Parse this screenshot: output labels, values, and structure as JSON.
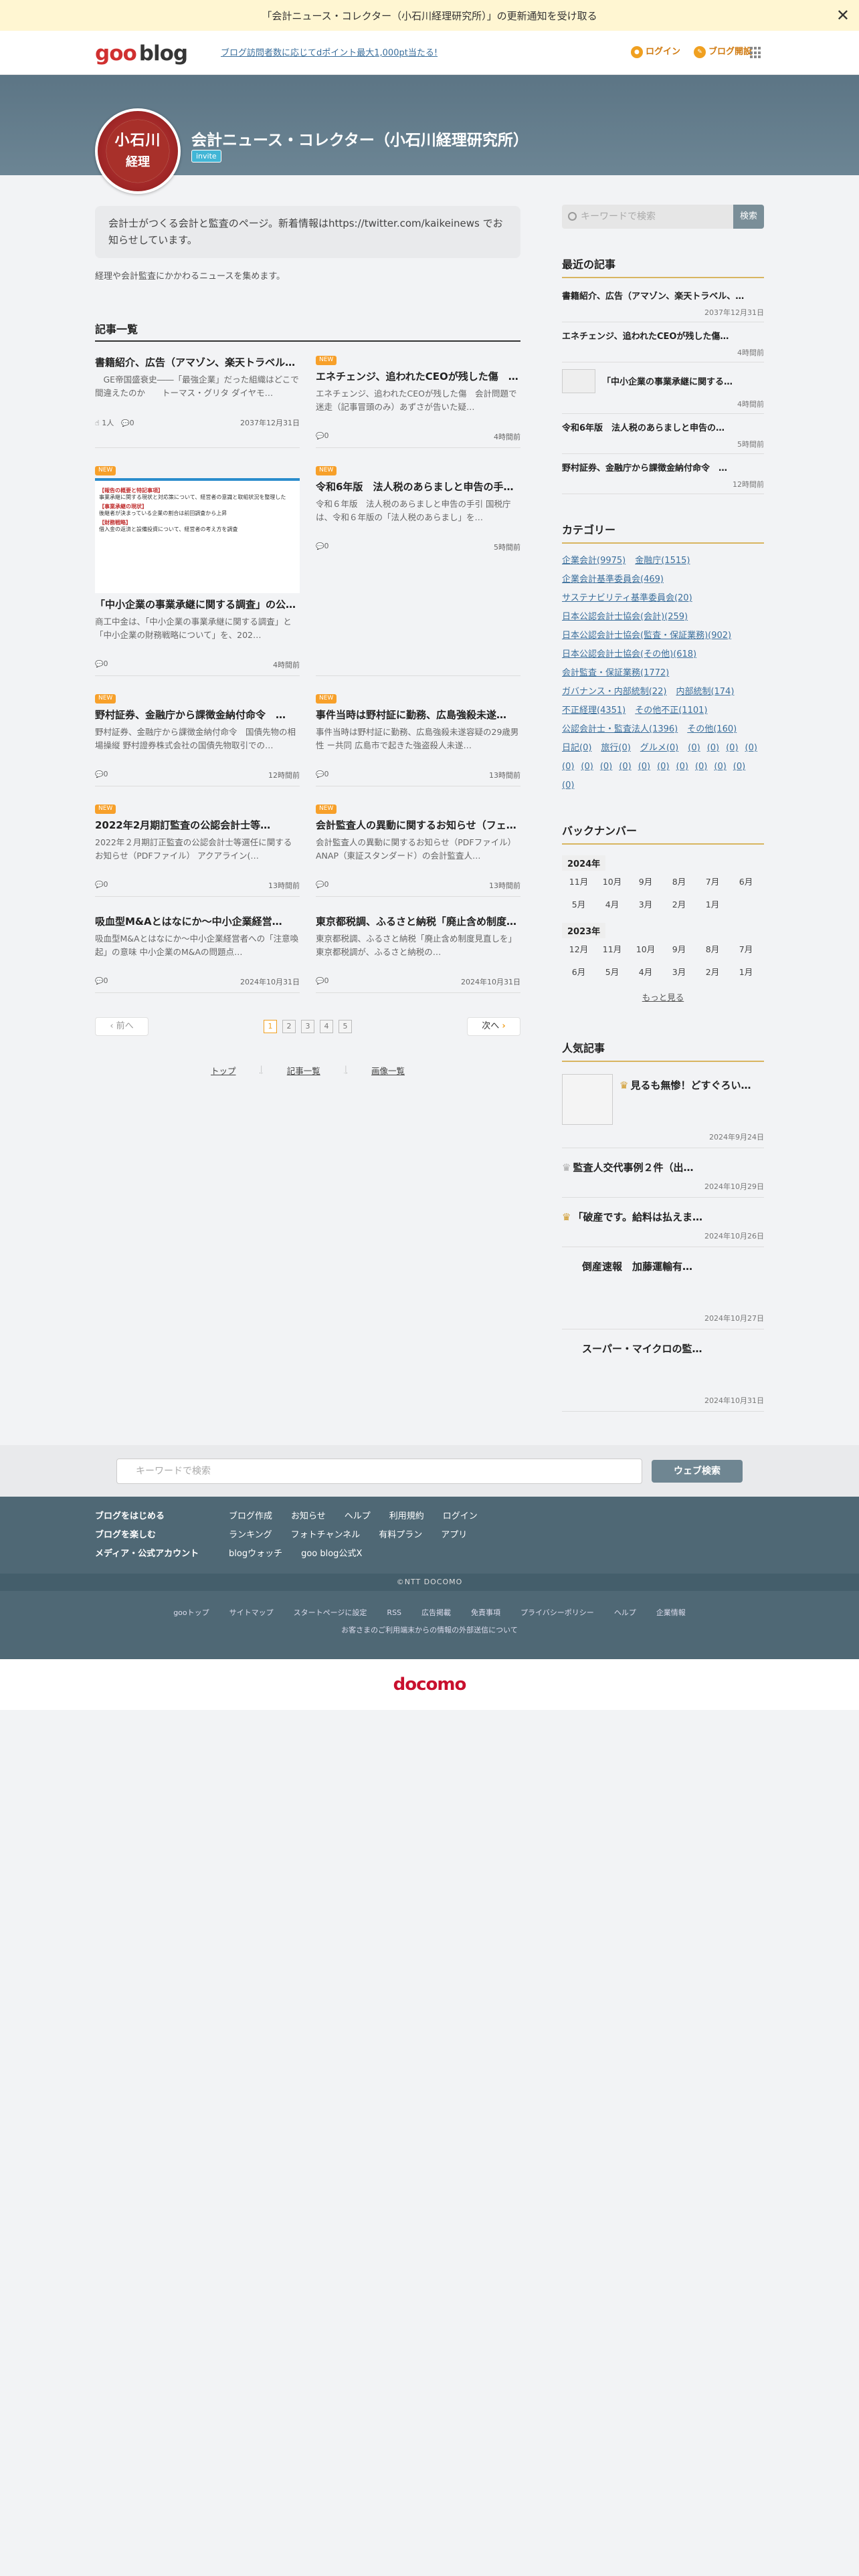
{
  "notice": {
    "text": "「会計ニュース・コレクター（小石川経理研究所）」の更新通知を受け取る",
    "close": "✕"
  },
  "header": {
    "logo_goo": "goo",
    "logo_blog": "blog",
    "promo": "ブログ訪問者数に応じてdポイント最大1,000pt当たる!",
    "login": "ログイン",
    "open": "ブログ開設"
  },
  "blog": {
    "title": "会計ニュース・コレクター（小石川経理研究所）",
    "badge": "invite",
    "avatar_l1": "小石川",
    "avatar_l2": "経理",
    "description": "会計士がつくる会計と監査のページ。新着情報はhttps://twitter.com/kaikeinews でお知らせしています。",
    "subdescription": "経理や会計監査にかかわるニュースを集めます。"
  },
  "articles_heading": "記事一覧",
  "articles": [
    {
      "new": "",
      "title": "書籍紹介、広告（アマゾン、楽天トラベル、…",
      "excerpt": "　GE帝国盛衰史――「最強企業」だった組織はどこで間違えたのか　　トーマス・グリタ ダイヤモ…",
      "left": "1人",
      "comments": "0",
      "date": "2037年12月31日"
    },
    {
      "new": "NEW",
      "title": "エネチェンジ、追われたCEOが残した傷　…",
      "excerpt": "エネチェンジ、追われたCEOが残した傷　会計問題で迷走（記事冒頭のみ）あずさが告いた疑…",
      "left": "",
      "comments": "0",
      "date": "4時間前"
    },
    {
      "new": "NEW",
      "title": "「中小企業の事業承継に関する調査」の公…",
      "excerpt": "商工中金は、「中小企業の事業承継に関する調査」と「中小企業の財務戦略について」を、202…",
      "left": "",
      "comments": "0",
      "date": "4時間前",
      "image": true
    },
    {
      "new": "NEW",
      "title": "令和6年版　法人税のあらましと申告の手…",
      "excerpt": "令和６年版　法人税のあらましと申告の手引 国税庁は、令和６年版の「法人税のあらまし」を…",
      "left": "",
      "comments": "0",
      "date": "5時間前"
    },
    {
      "new": "NEW",
      "title": "野村証券、金融庁から課徴金納付命令　…",
      "excerpt": "野村証券、金融庁から課徴金納付命令　国債先物の相場操縦 野村證券株式会社の国債先物取引での…",
      "left": "",
      "comments": "0",
      "date": "12時間前"
    },
    {
      "new": "NEW",
      "title": "事件当時は野村証に勤務、広島強殺未遂…",
      "excerpt": "事件当時は野村証に勤務、広島強殺未遂容疑の29歳男性 ー共同 広島市で起きた強盗殺人未遂…",
      "left": "",
      "comments": "0",
      "date": "13時間前"
    },
    {
      "new": "NEW",
      "title": "2022年2月期訂監査の公認会計士等…",
      "excerpt": "2022年２月期訂正監査の公認会計士等選任に関するお知らせ（PDFファイル） アクアライン(…",
      "left": "",
      "comments": "0",
      "date": "13時間前"
    },
    {
      "new": "NEW",
      "title": "会計監査人の異動に関するお知らせ（フェ…",
      "excerpt": "会計監査人の異動に関するお知らせ（PDFファイル） ANAP（東証スタンダード）の会計監査人…",
      "left": "",
      "comments": "0",
      "date": "13時間前"
    },
    {
      "new": "",
      "title": "吸血型M&Aとはなにか〜中小企業経営…",
      "excerpt": "吸血型M&Aとはなにか〜中小企業経営者への「注意喚起」の意味 中小企業のM&Aの問題点…",
      "left": "",
      "comments": "0",
      "date": "2024年10月31日"
    },
    {
      "new": "",
      "title": "東京都税調、ふるさと納税「廃止含め制度…",
      "excerpt": "東京都税調、ふるさと納税「廃止含め制度見直しを」 東京都税調が、ふるさと納税の…",
      "left": "",
      "comments": "0",
      "date": "2024年10月31日"
    }
  ],
  "image_text": {
    "h1": "【報告の概要と特記事項】",
    "b1": "事業承継に関する現状と対応策について、経営者の意識と取組状況を整理した",
    "h2": "【事業承継の現状】",
    "b2": "後継者が決まっている企業の割合は前回調査から上昇",
    "h3": "【財務戦略】",
    "b3": "借入金の返済と設備投資について、経営者の考え方を調査"
  },
  "pager": {
    "prev": "前へ",
    "next": "次へ",
    "pages": [
      "1",
      "2",
      "3",
      "4",
      "5"
    ]
  },
  "footer_links": [
    "トップ",
    "記事一覧",
    "画像一覧"
  ],
  "sidebar": {
    "search_placeholder": "キーワードで検索",
    "search_button": "検索",
    "recent_heading": "最近の記事",
    "recent": [
      {
        "title": "書籍紹介、広告（アマゾン、楽天トラベル、…",
        "date": "2037年12月31日"
      },
      {
        "title": "エネチェンジ、追われたCEOが残した傷…",
        "date": "4時間前"
      },
      {
        "title": "「中小企業の事業承継に関する…",
        "date": "4時間前",
        "thumb": true
      },
      {
        "title": "令和6年版　法人税のあらましと申告の…",
        "date": "5時間前"
      },
      {
        "title": "野村証券、金融庁から課徴金納付命令　…",
        "date": "12時間前"
      }
    ],
    "category_heading": "カテゴリー",
    "categories": [
      "企業会計(9975)",
      "金融庁(1515)",
      "企業会計基準委員会(469)",
      "サステナビリティ基準委員会(20)",
      "日本公認会計士協会(会計)(259)",
      "日本公認会計士協会(監査・保証業務)(902)",
      "日本公認会計士協会(その他)(618)",
      "会計監査・保証業務(1772)",
      "ガバナンス・内部統制(22)",
      "内部統制(174)",
      "不正経理(4351)",
      "その他不正(1101)",
      "公認会計士・監査法人(1396)",
      "その他(160)",
      "日記(0)",
      "旅行(0)",
      "グルメ(0)",
      "(0)",
      "(0)",
      "(0)",
      "(0)",
      "(0)",
      "(0)",
      "(0)",
      "(0)",
      "(0)",
      "(0)",
      "(0)",
      "(0)",
      "(0)",
      "(0)",
      "(0)"
    ],
    "backnumber_heading": "バックナンバー",
    "years": [
      {
        "year": "2024年",
        "months": [
          "11月",
          "10月",
          "9月",
          "8月",
          "7月",
          "6月",
          "5月",
          "4月",
          "3月",
          "2月",
          "1月"
        ]
      },
      {
        "year": "2023年",
        "months": [
          "12月",
          "11月",
          "10月",
          "9月",
          "8月",
          "7月",
          "6月",
          "5月",
          "4月",
          "3月",
          "2月",
          "1月"
        ]
      }
    ],
    "more": "もっと見る",
    "popular_heading": "人気記事",
    "popular": [
      {
        "title": "見るも無惨！どすぐろい…",
        "date": "2024年9月24日",
        "crown": "gold",
        "thumb": true
      },
      {
        "title": "監査人交代事例２件（出…",
        "date": "2024年10月29日",
        "crown": "silver"
      },
      {
        "title": "「破産です。給料は払えま…",
        "date": "2024年10月26日",
        "crown": "bronze"
      },
      {
        "title": "倒産速報　加藤運輸有…",
        "date": "2024年10月27日",
        "crown": ""
      },
      {
        "title": "スーパー・マイクロの監…",
        "date": "2024年10月31日",
        "crown": ""
      }
    ]
  },
  "footer": {
    "search_placeholder": "キーワードで検索",
    "search_button": "ウェブ検索",
    "row1_head": "ブログをはじめる",
    "row1": [
      "ブログ作成",
      "お知らせ",
      "ヘルプ",
      "利用規約",
      "ログイン"
    ],
    "row2_head": "ブログを楽しむ",
    "row2": [
      "ランキング",
      "フォトチャンネル",
      "有料プラン",
      "アプリ"
    ],
    "row3_head": "メディア・公式アカウント",
    "row3": [
      "blogウォッチ",
      "goo blog公式X"
    ],
    "copyright": "©NTT DOCOMO",
    "links": [
      "gooトップ",
      "サイトマップ",
      "スタートページに設定",
      "RSS",
      "広告掲載",
      "免責事項",
      "プライバシーポリシー",
      "ヘルプ",
      "企業情報"
    ],
    "notice": "お客さまのご利用端末からの情報の外部送信について",
    "docomo": "docomo"
  }
}
